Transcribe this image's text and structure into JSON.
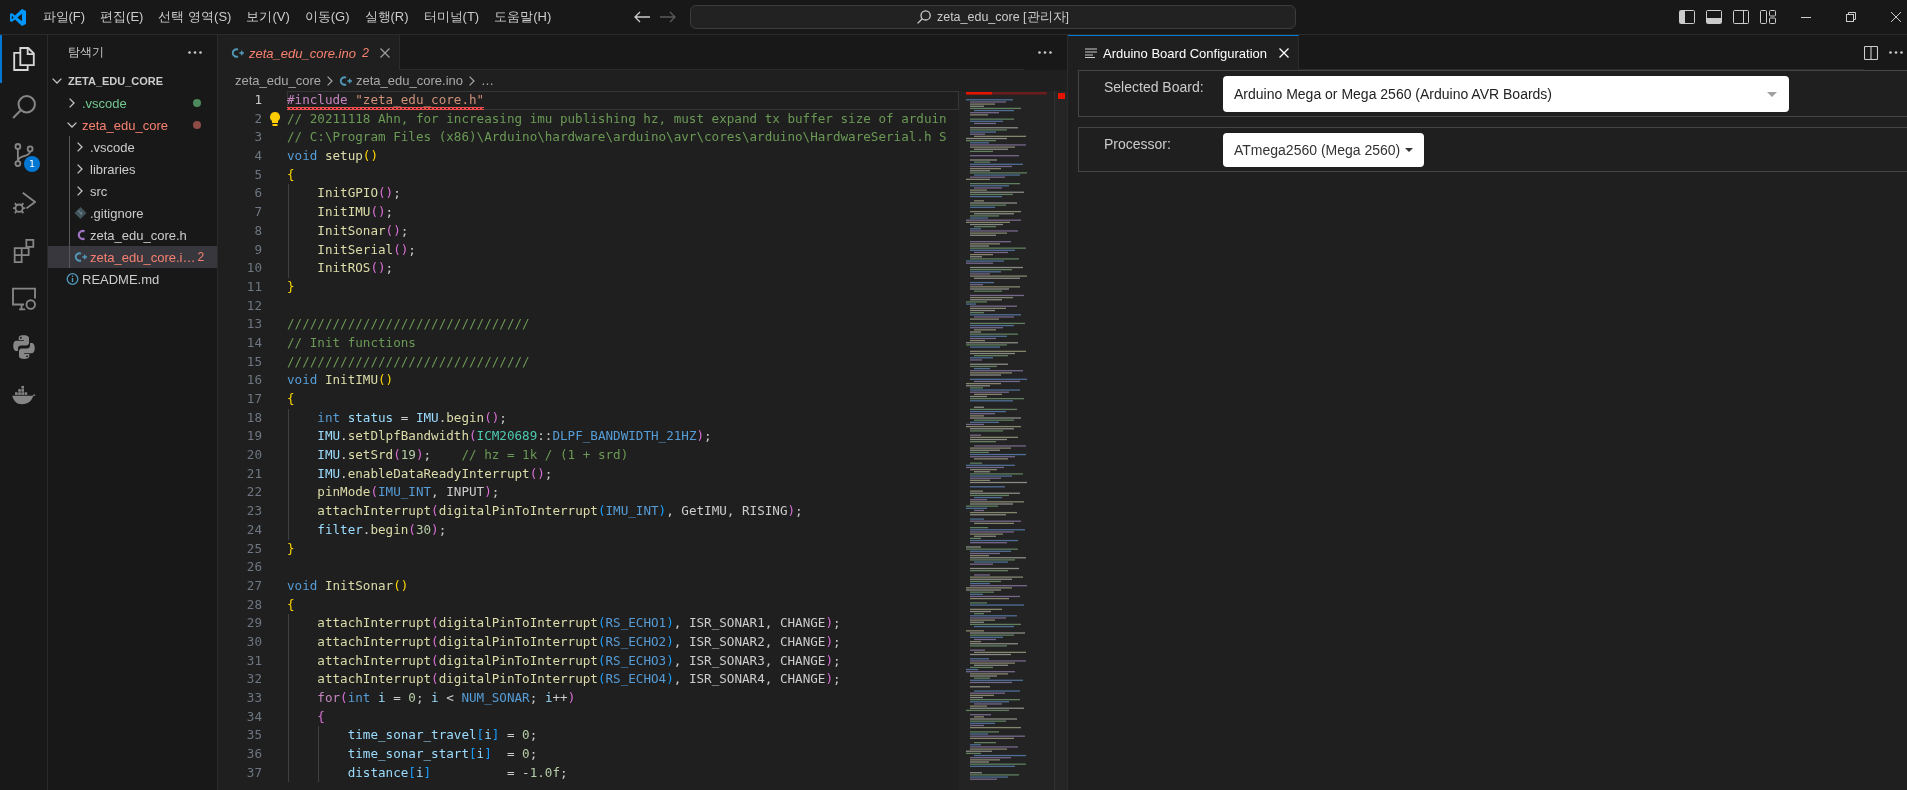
{
  "title_bar": {
    "menu": [
      "파일(F)",
      "편집(E)",
      "선택 영역(S)",
      "보기(V)",
      "이동(G)",
      "실행(R)",
      "터미널(T)",
      "도움말(H)"
    ],
    "nav": [
      {
        "kind": "back",
        "disabled": false
      },
      {
        "kind": "forward",
        "disabled": true
      }
    ],
    "command_center": "zeta_edu_core [관리자]"
  },
  "activity_bar": [
    {
      "kind": "explorer",
      "selected": true
    },
    {
      "kind": "search",
      "selected": false
    },
    {
      "kind": "source-control",
      "selected": false,
      "badge": "1"
    },
    {
      "kind": "run-debug",
      "selected": false
    },
    {
      "kind": "extensions",
      "selected": false
    },
    {
      "kind": "remote-explorer",
      "selected": false
    },
    {
      "kind": "python",
      "selected": false
    },
    {
      "kind": "docker",
      "selected": false
    }
  ],
  "explorer": {
    "title": "탐색기",
    "root": {
      "name": "ZETA_EDU_CORE",
      "expanded": true
    },
    "tree": [
      {
        "name": ".vscode",
        "kind": "folder",
        "expanded": false,
        "untracked": true,
        "errors": false,
        "selected": false
      },
      {
        "name": "zeta_edu_core",
        "kind": "folder",
        "expanded": true,
        "untracked": false,
        "errors": true,
        "selected": false,
        "children": [
          {
            "name": ".vscode",
            "kind": "folder",
            "expanded": false,
            "untracked": false,
            "errors": false,
            "selected": false
          },
          {
            "name": "libraries",
            "kind": "folder",
            "expanded": false,
            "untracked": false,
            "errors": false,
            "selected": false
          },
          {
            "name": "src",
            "kind": "folder",
            "expanded": false,
            "untracked": false,
            "errors": false,
            "selected": false
          },
          {
            "name": ".gitignore",
            "kind": "gitignore",
            "untracked": false,
            "errors": false,
            "selected": false
          },
          {
            "name": "zeta_edu_core.h",
            "kind": "header",
            "untracked": false,
            "errors": false,
            "selected": false
          },
          {
            "name": "zeta_edu_core.i…",
            "kind": "sketch",
            "untracked": false,
            "errors": true,
            "selected": true,
            "badge": "2"
          }
        ]
      },
      {
        "name": "README.md",
        "kind": "readme",
        "untracked": false,
        "errors": false,
        "selected": false
      }
    ]
  },
  "editor": {
    "tab": {
      "label": "zeta_edu_core.ino",
      "badge": "2",
      "kind": "sketch",
      "preview": true,
      "errors": true,
      "focused": false
    },
    "breadcrumbs": [
      {
        "kind": "folder",
        "text": "zeta_edu_core"
      },
      {
        "kind": "sketch",
        "text": "zeta_edu_core.ino"
      },
      {
        "kind": "more",
        "text": "…"
      }
    ],
    "lines": [
      {
        "number": "1",
        "current": true,
        "error": true,
        "lightbulb": false,
        "tokens": [
          {
            "kind": "directive",
            "text": "#include"
          },
          {
            "kind": "string",
            "text": " \"zeta_edu_core.h\""
          }
        ]
      },
      {
        "number": "2",
        "current": false,
        "error": false,
        "lightbulb": true,
        "tokens": [
          {
            "kind": "comment",
            "text": "// 20211118 Ahn, for increasing imu publishing hz, must expand tx buffer size of arduin"
          }
        ]
      },
      {
        "number": "3",
        "current": false,
        "error": false,
        "lightbulb": false,
        "tokens": [
          {
            "kind": "comment",
            "text": "// C:\\Program Files (x86)\\Arduino\\hardware\\arduino\\avr\\cores\\arduino\\HardwareSerial.h S"
          }
        ]
      },
      {
        "number": "4",
        "current": false,
        "error": false,
        "lightbulb": false,
        "tokens": [
          {
            "kind": "keyword",
            "text": "void"
          },
          {
            "kind": "function",
            "text": " setup"
          },
          {
            "kind": "bracket1",
            "text": "()"
          }
        ]
      },
      {
        "number": "5",
        "current": false,
        "error": false,
        "lightbulb": false,
        "tokens": [
          {
            "kind": "bracket1",
            "text": "{"
          }
        ]
      },
      {
        "number": "6",
        "current": false,
        "error": false,
        "lightbulb": false,
        "tokens": [
          {
            "kind": "function",
            "text": "    InitGPIO"
          },
          {
            "kind": "bracket2",
            "text": "()"
          },
          {
            "kind": "plain",
            "text": ";"
          }
        ]
      },
      {
        "number": "7",
        "current": false,
        "error": false,
        "lightbulb": false,
        "tokens": [
          {
            "kind": "function",
            "text": "    InitIMU"
          },
          {
            "kind": "bracket2",
            "text": "()"
          },
          {
            "kind": "plain",
            "text": ";"
          }
        ]
      },
      {
        "number": "8",
        "current": false,
        "error": false,
        "lightbulb": false,
        "tokens": [
          {
            "kind": "function",
            "text": "    InitSonar"
          },
          {
            "kind": "bracket2",
            "text": "()"
          },
          {
            "kind": "plain",
            "text": ";"
          }
        ]
      },
      {
        "number": "9",
        "current": false,
        "error": false,
        "lightbulb": false,
        "tokens": [
          {
            "kind": "function",
            "text": "    InitSerial"
          },
          {
            "kind": "bracket2",
            "text": "()"
          },
          {
            "kind": "plain",
            "text": ";"
          }
        ]
      },
      {
        "number": "10",
        "current": false,
        "error": false,
        "lightbulb": false,
        "tokens": [
          {
            "kind": "function",
            "text": "    InitROS"
          },
          {
            "kind": "bracket2",
            "text": "()"
          },
          {
            "kind": "plain",
            "text": ";"
          }
        ]
      },
      {
        "number": "11",
        "current": false,
        "error": false,
        "lightbulb": false,
        "tokens": [
          {
            "kind": "bracket1",
            "text": "}"
          }
        ]
      },
      {
        "number": "12",
        "current": false,
        "error": false,
        "lightbulb": false
      },
      {
        "number": "13",
        "current": false,
        "error": false,
        "lightbulb": false,
        "tokens": [
          {
            "kind": "comment",
            "text": "////////////////////////////////"
          }
        ]
      },
      {
        "number": "14",
        "current": false,
        "error": false,
        "lightbulb": false,
        "tokens": [
          {
            "kind": "comment",
            "text": "// Init functions"
          }
        ]
      },
      {
        "number": "15",
        "current": false,
        "error": false,
        "lightbulb": false,
        "tokens": [
          {
            "kind": "comment",
            "text": "////////////////////////////////"
          }
        ]
      },
      {
        "number": "16",
        "current": false,
        "error": false,
        "lightbulb": false,
        "tokens": [
          {
            "kind": "keyword",
            "text": "void"
          },
          {
            "kind": "function",
            "text": " InitIMU"
          },
          {
            "kind": "bracket1",
            "text": "()"
          }
        ]
      },
      {
        "number": "17",
        "current": false,
        "error": false,
        "lightbulb": false,
        "tokens": [
          {
            "kind": "bracket1",
            "text": "{"
          }
        ]
      },
      {
        "number": "18",
        "current": false,
        "error": false,
        "lightbulb": false,
        "tokens": [
          {
            "kind": "keyword",
            "text": "    int"
          },
          {
            "kind": "variable",
            "text": " status"
          },
          {
            "kind": "plain",
            "text": " = "
          },
          {
            "kind": "variable",
            "text": "IMU"
          },
          {
            "kind": "plain",
            "text": "."
          },
          {
            "kind": "function",
            "text": "begin"
          },
          {
            "kind": "bracket2",
            "text": "()"
          },
          {
            "kind": "plain",
            "text": ";"
          }
        ]
      },
      {
        "number": "19",
        "current": false,
        "error": false,
        "lightbulb": false,
        "tokens": [
          {
            "kind": "variable",
            "text": "    IMU"
          },
          {
            "kind": "plain",
            "text": "."
          },
          {
            "kind": "function",
            "text": "setDlpfBandwidth"
          },
          {
            "kind": "bracket2",
            "text": "("
          },
          {
            "kind": "type",
            "text": "ICM20689"
          },
          {
            "kind": "plain",
            "text": "::"
          },
          {
            "kind": "macro",
            "text": "DLPF_BANDWIDTH_21HZ"
          },
          {
            "kind": "bracket2",
            "text": ")"
          },
          {
            "kind": "plain",
            "text": ";"
          }
        ]
      },
      {
        "number": "20",
        "current": false,
        "error": false,
        "lightbulb": false,
        "tokens": [
          {
            "kind": "variable",
            "text": "    IMU"
          },
          {
            "kind": "plain",
            "text": "."
          },
          {
            "kind": "function",
            "text": "setSrd"
          },
          {
            "kind": "bracket2",
            "text": "("
          },
          {
            "kind": "number",
            "text": "19"
          },
          {
            "kind": "bracket2",
            "text": ")"
          },
          {
            "kind": "plain",
            "text": ";"
          },
          {
            "kind": "comment",
            "text": "    // hz = 1k / (1 + srd)"
          }
        ]
      },
      {
        "number": "21",
        "current": false,
        "error": false,
        "lightbulb": false,
        "tokens": [
          {
            "kind": "variable",
            "text": "    IMU"
          },
          {
            "kind": "plain",
            "text": "."
          },
          {
            "kind": "function",
            "text": "enableDataReadyInterrupt"
          },
          {
            "kind": "bracket2",
            "text": "()"
          },
          {
            "kind": "plain",
            "text": ";"
          }
        ]
      },
      {
        "number": "22",
        "current": false,
        "error": false,
        "lightbulb": false,
        "tokens": [
          {
            "kind": "function",
            "text": "    pinMode"
          },
          {
            "kind": "bracket2",
            "text": "("
          },
          {
            "kind": "macro",
            "text": "IMU_INT"
          },
          {
            "kind": "plain",
            "text": ", INPUT"
          },
          {
            "kind": "bracket2",
            "text": ")"
          },
          {
            "kind": "plain",
            "text": ";"
          }
        ]
      },
      {
        "number": "23",
        "current": false,
        "error": false,
        "lightbulb": false,
        "tokens": [
          {
            "kind": "function",
            "text": "    attachInterrupt"
          },
          {
            "kind": "bracket2",
            "text": "("
          },
          {
            "kind": "function",
            "text": "digitalPinToInterrupt"
          },
          {
            "kind": "bracket3",
            "text": "("
          },
          {
            "kind": "macro",
            "text": "IMU_INT"
          },
          {
            "kind": "bracket3",
            "text": ")"
          },
          {
            "kind": "plain",
            "text": ", GetIMU, RISING"
          },
          {
            "kind": "bracket2",
            "text": ")"
          },
          {
            "kind": "plain",
            "text": ";"
          }
        ]
      },
      {
        "number": "24",
        "current": false,
        "error": false,
        "lightbulb": false,
        "tokens": [
          {
            "kind": "variable",
            "text": "    filter"
          },
          {
            "kind": "plain",
            "text": "."
          },
          {
            "kind": "function",
            "text": "begin"
          },
          {
            "kind": "bracket2",
            "text": "("
          },
          {
            "kind": "number",
            "text": "30"
          },
          {
            "kind": "bracket2",
            "text": ")"
          },
          {
            "kind": "plain",
            "text": ";"
          }
        ]
      },
      {
        "number": "25",
        "current": false,
        "error": false,
        "lightbulb": false,
        "tokens": [
          {
            "kind": "bracket1",
            "text": "}"
          }
        ]
      },
      {
        "number": "26",
        "current": false,
        "error": false,
        "lightbulb": false
      },
      {
        "number": "27",
        "current": false,
        "error": false,
        "lightbulb": false,
        "tokens": [
          {
            "kind": "keyword",
            "text": "void"
          },
          {
            "kind": "function",
            "text": " InitSonar"
          },
          {
            "kind": "bracket1",
            "text": "()"
          }
        ]
      },
      {
        "number": "28",
        "current": false,
        "error": false,
        "lightbulb": false,
        "tokens": [
          {
            "kind": "bracket1",
            "text": "{"
          }
        ]
      },
      {
        "number": "29",
        "current": false,
        "error": false,
        "lightbulb": false,
        "tokens": [
          {
            "kind": "function",
            "text": "    attachInterrupt"
          },
          {
            "kind": "bracket2",
            "text": "("
          },
          {
            "kind": "function",
            "text": "digitalPinToInterrupt"
          },
          {
            "kind": "bracket3",
            "text": "("
          },
          {
            "kind": "macro",
            "text": "RS_ECHO1"
          },
          {
            "kind": "bracket3",
            "text": ")"
          },
          {
            "kind": "plain",
            "text": ", ISR_SONAR1, CHANGE"
          },
          {
            "kind": "bracket2",
            "text": ")"
          },
          {
            "kind": "plain",
            "text": ";"
          }
        ]
      },
      {
        "number": "30",
        "current": false,
        "error": false,
        "lightbulb": false,
        "tokens": [
          {
            "kind": "function",
            "text": "    attachInterrupt"
          },
          {
            "kind": "bracket2",
            "text": "("
          },
          {
            "kind": "function",
            "text": "digitalPinToInterrupt"
          },
          {
            "kind": "bracket3",
            "text": "("
          },
          {
            "kind": "macro",
            "text": "RS_ECHO2"
          },
          {
            "kind": "bracket3",
            "text": ")"
          },
          {
            "kind": "plain",
            "text": ", ISR_SONAR2, CHANGE"
          },
          {
            "kind": "bracket2",
            "text": ")"
          },
          {
            "kind": "plain",
            "text": ";"
          }
        ]
      },
      {
        "number": "31",
        "current": false,
        "error": false,
        "lightbulb": false,
        "tokens": [
          {
            "kind": "function",
            "text": "    attachInterrupt"
          },
          {
            "kind": "bracket2",
            "text": "("
          },
          {
            "kind": "function",
            "text": "digitalPinToInterrupt"
          },
          {
            "kind": "bracket3",
            "text": "("
          },
          {
            "kind": "macro",
            "text": "RS_ECHO3"
          },
          {
            "kind": "bracket3",
            "text": ")"
          },
          {
            "kind": "plain",
            "text": ", ISR_SONAR3, CHANGE"
          },
          {
            "kind": "bracket2",
            "text": ")"
          },
          {
            "kind": "plain",
            "text": ";"
          }
        ]
      },
      {
        "number": "32",
        "current": false,
        "error": false,
        "lightbulb": false,
        "tokens": [
          {
            "kind": "function",
            "text": "    attachInterrupt"
          },
          {
            "kind": "bracket2",
            "text": "("
          },
          {
            "kind": "function",
            "text": "digitalPinToInterrupt"
          },
          {
            "kind": "bracket3",
            "text": "("
          },
          {
            "kind": "macro",
            "text": "RS_ECHO4"
          },
          {
            "kind": "bracket3",
            "text": ")"
          },
          {
            "kind": "plain",
            "text": ", ISR_SONAR4, CHANGE"
          },
          {
            "kind": "bracket2",
            "text": ")"
          },
          {
            "kind": "plain",
            "text": ";"
          }
        ]
      },
      {
        "number": "33",
        "current": false,
        "error": false,
        "lightbulb": false,
        "tokens": [
          {
            "kind": "control",
            "text": "    for"
          },
          {
            "kind": "bracket2",
            "text": "("
          },
          {
            "kind": "keyword",
            "text": "int"
          },
          {
            "kind": "variable",
            "text": " i"
          },
          {
            "kind": "plain",
            "text": " = "
          },
          {
            "kind": "number",
            "text": "0"
          },
          {
            "kind": "plain",
            "text": "; "
          },
          {
            "kind": "variable",
            "text": "i"
          },
          {
            "kind": "plain",
            "text": " < "
          },
          {
            "kind": "macro",
            "text": "NUM_SONAR"
          },
          {
            "kind": "plain",
            "text": "; "
          },
          {
            "kind": "variable",
            "text": "i"
          },
          {
            "kind": "plain",
            "text": "++"
          },
          {
            "kind": "bracket2",
            "text": ")"
          }
        ]
      },
      {
        "number": "34",
        "current": false,
        "error": false,
        "lightbulb": false,
        "tokens": [
          {
            "kind": "bracket2",
            "text": "    {"
          }
        ]
      },
      {
        "number": "35",
        "current": false,
        "error": false,
        "lightbulb": false,
        "tokens": [
          {
            "kind": "variable",
            "text": "        time_sonar_travel"
          },
          {
            "kind": "bracket3",
            "text": "["
          },
          {
            "kind": "variable",
            "text": "i"
          },
          {
            "kind": "bracket3",
            "text": "]"
          },
          {
            "kind": "plain",
            "text": " = "
          },
          {
            "kind": "number",
            "text": "0"
          },
          {
            "kind": "plain",
            "text": ";"
          }
        ]
      },
      {
        "number": "36",
        "current": false,
        "error": false,
        "lightbulb": false,
        "tokens": [
          {
            "kind": "variable",
            "text": "        time_sonar_start"
          },
          {
            "kind": "bracket3",
            "text": "["
          },
          {
            "kind": "variable",
            "text": "i"
          },
          {
            "kind": "bracket3",
            "text": "]"
          },
          {
            "kind": "plain",
            "text": "  = "
          },
          {
            "kind": "number",
            "text": "0"
          },
          {
            "kind": "plain",
            "text": ";"
          }
        ]
      },
      {
        "number": "37",
        "current": false,
        "error": false,
        "lightbulb": false,
        "tokens": [
          {
            "kind": "variable",
            "text": "        distance"
          },
          {
            "kind": "bracket3",
            "text": "["
          },
          {
            "kind": "variable",
            "text": "i"
          },
          {
            "kind": "bracket3",
            "text": "]"
          },
          {
            "kind": "plain",
            "text": "          = -"
          },
          {
            "kind": "number",
            "text": "1.0f"
          },
          {
            "kind": "plain",
            "text": ";"
          }
        ]
      }
    ]
  },
  "board_panel": {
    "tab": {
      "label": "Arduino Board Configuration",
      "kind": "webview",
      "preview": false,
      "errors": false,
      "focused": true
    },
    "fields": [
      {
        "label": "Selected Board:",
        "kind": "select",
        "value": "Arduino Mega or Mega 2560 (Arduino AVR Boards)"
      },
      {
        "label": "Processor:",
        "kind": "menu-button",
        "value": "ATmega2560 (Mega 2560)"
      }
    ]
  }
}
